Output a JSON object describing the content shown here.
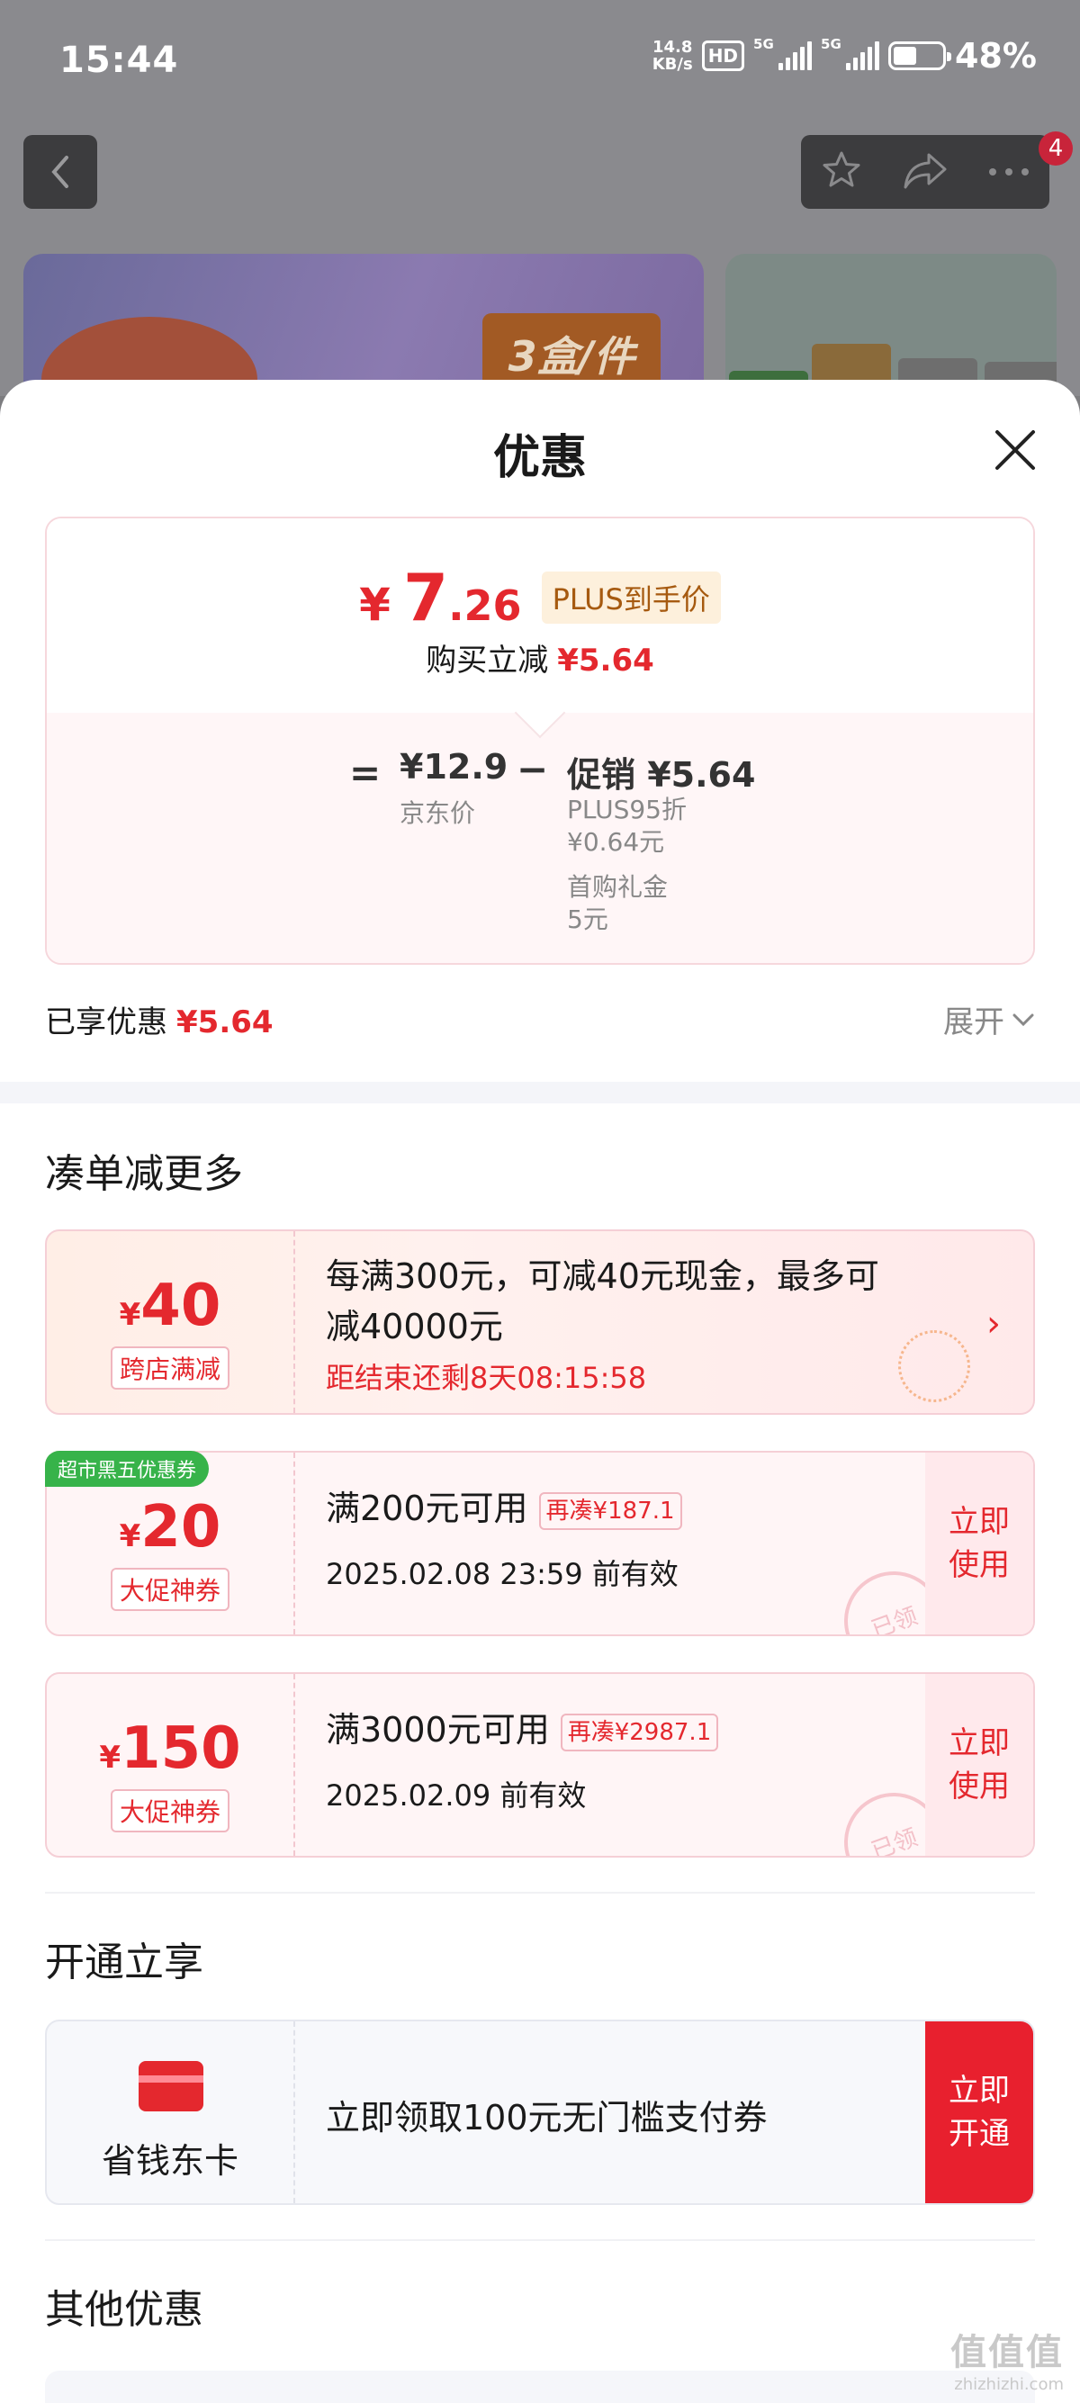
{
  "status_bar": {
    "time": "15:44",
    "speed_value": "14.8",
    "speed_unit": "KB/s",
    "hd": "HD",
    "net1": "5G",
    "net2": "5G",
    "battery_pct_text": "48%",
    "battery_level": 0.48
  },
  "background_page": {
    "notification_count": "4",
    "banner_tag": "3盒/件"
  },
  "sheet": {
    "title": "优惠",
    "price_summary": {
      "currency": "¥",
      "final_int": "7",
      "final_dec": ".26",
      "plus_tag": "PLUS到手价",
      "instant_label": "购买立减",
      "instant_amount": "¥5.64",
      "eq": "=",
      "jd_price": "¥12.9",
      "jd_label": "京东价",
      "minus": "−",
      "promo": "促销 ¥5.64",
      "promo_lines": [
        "PLUS95折",
        "¥0.64元",
        "首购礼金",
        "5元"
      ]
    },
    "enjoyed_label": "已享优惠",
    "enjoyed_amount": "¥5.64",
    "expand_label": "展开",
    "section_more": "凑单减更多",
    "coupons": [
      {
        "currency": "¥",
        "amount": "40",
        "tag": "跨店满减",
        "line1": "每满300元，可减40元现金，最多可",
        "line2": "减40000元",
        "countdown": "距结束还剩8天08:15:58"
      },
      {
        "badge": "超市黑五优惠券",
        "currency": "¥",
        "amount": "20",
        "tag": "大促神券",
        "condition": "满200元可用",
        "reup": "再凑¥187.1",
        "valid": "2025.02.08 23:59 前有效",
        "action": "立即使用",
        "stamp": "已领"
      },
      {
        "currency": "¥",
        "amount": "150",
        "tag": "大促神券",
        "condition": "满3000元可用",
        "reup": "再凑¥2987.1",
        "valid": "2025.02.09 前有效",
        "action": "立即使用",
        "stamp": "已领"
      }
    ],
    "section_open": "开通立享",
    "card": {
      "name": "省钱东卡",
      "desc": "立即领取100元无门槛支付券",
      "action": "立即开通"
    },
    "section_other": "其他优惠"
  },
  "watermark": {
    "logo": "值值值",
    "url": "zhizhizhi.com"
  },
  "colors": {
    "accent_red": "#e4282e",
    "plus_gold": "#a65a10",
    "badge_green": "#37b34a"
  }
}
